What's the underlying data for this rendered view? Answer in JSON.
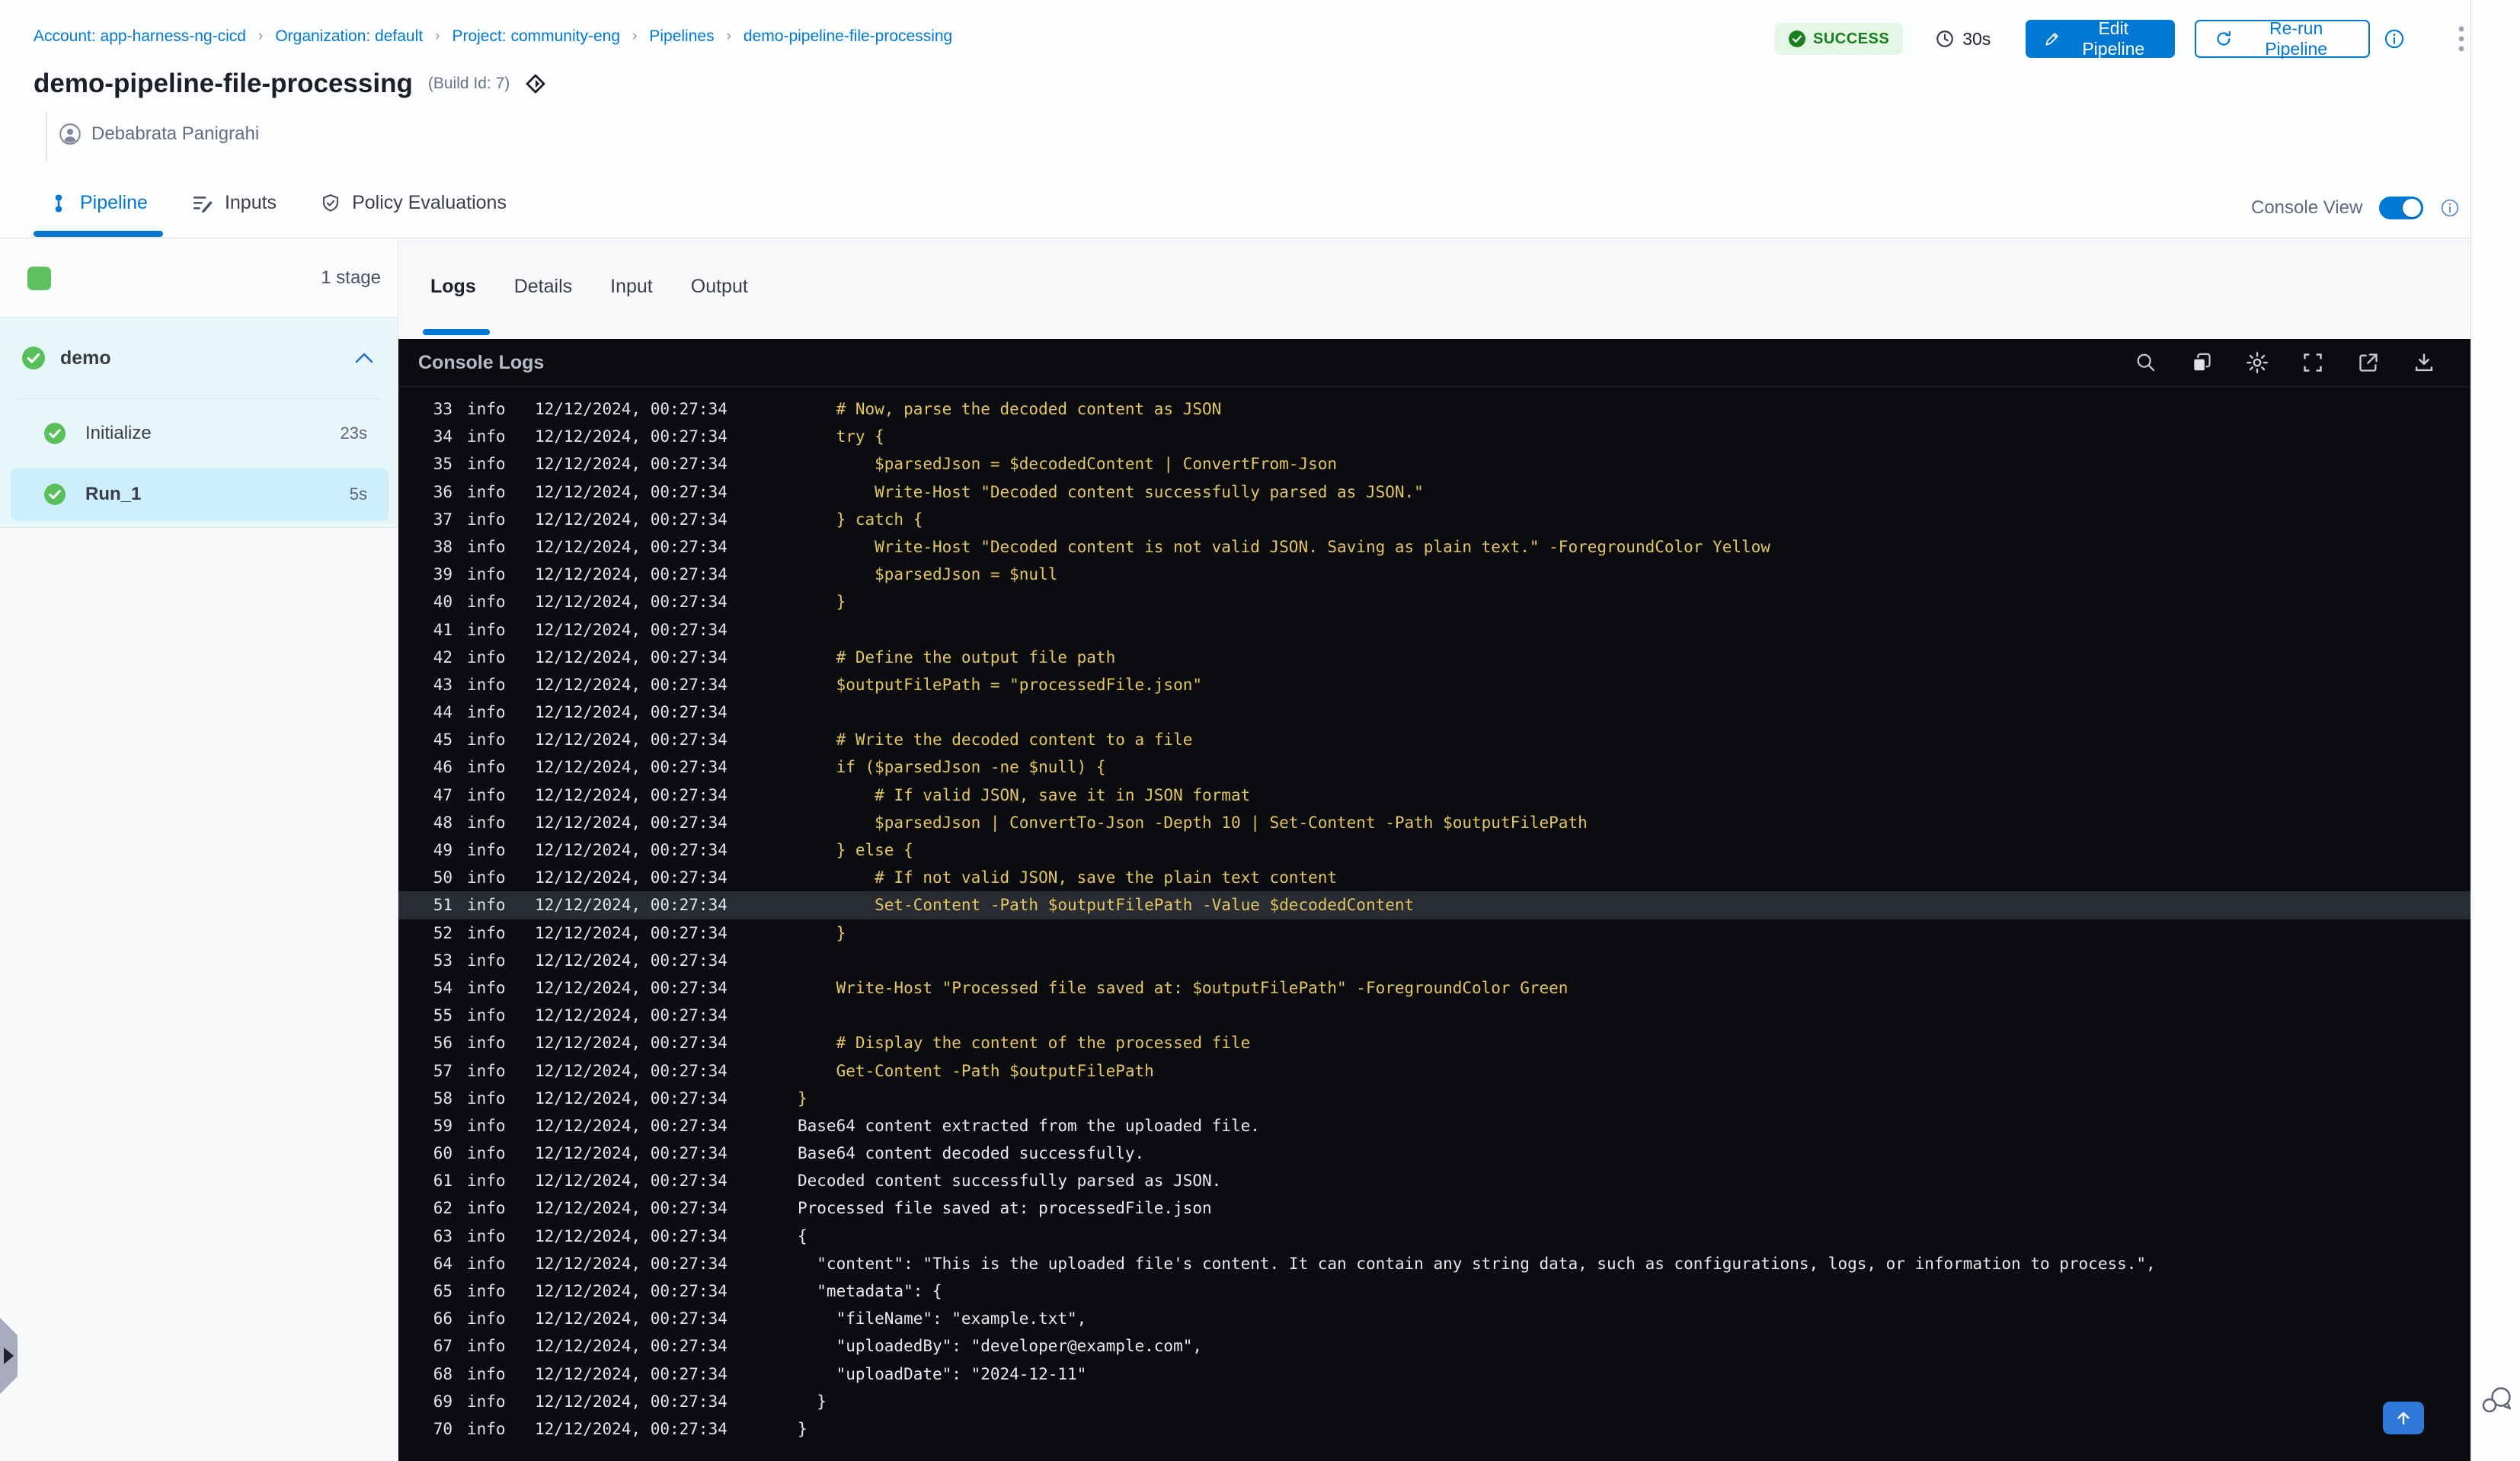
{
  "breadcrumb": {
    "separator": "›",
    "items": [
      "Account: app-harness-ng-cicd",
      "Organization: default",
      "Project: community-eng",
      "Pipelines",
      "demo-pipeline-file-processing"
    ]
  },
  "header": {
    "title": "demo-pipeline-file-processing",
    "build_id": "(Build Id: 7)",
    "author": "Debabrata Panigrahi",
    "status": "SUCCESS",
    "duration": "30s",
    "edit_button": "Edit Pipeline",
    "rerun_button": "Re-run Pipeline"
  },
  "tabs": {
    "items": [
      "Pipeline",
      "Inputs",
      "Policy Evaluations"
    ],
    "active": "Pipeline",
    "console_view_label": "Console View",
    "console_view_on": true
  },
  "sidebar": {
    "stage_count": "1 stage",
    "stage_group": {
      "name": "demo",
      "status": "success"
    },
    "steps": [
      {
        "name": "Initialize",
        "duration": "23s",
        "status": "success",
        "selected": false
      },
      {
        "name": "Run_1",
        "duration": "5s",
        "status": "success",
        "selected": true
      }
    ]
  },
  "console": {
    "tabs": [
      "Logs",
      "Details",
      "Input",
      "Output"
    ],
    "active_tab": "Logs",
    "title": "Console Logs",
    "icons": [
      "search-icon",
      "copy-icon",
      "settings-icon",
      "fullscreen-icon",
      "open-in-new-icon",
      "download-icon"
    ]
  },
  "logs": {
    "level": "info",
    "timestamp": "12/12/2024, 00:27:34",
    "highlighted_line": 51,
    "lines": [
      {
        "n": 33,
        "type": "script",
        "text": "    # Now, parse the decoded content as JSON"
      },
      {
        "n": 34,
        "type": "script",
        "text": "    try {"
      },
      {
        "n": 35,
        "type": "script",
        "text": "        $parsedJson = $decodedContent | ConvertFrom-Json"
      },
      {
        "n": 36,
        "type": "script",
        "text": "        Write-Host \"Decoded content successfully parsed as JSON.\""
      },
      {
        "n": 37,
        "type": "script",
        "text": "    } catch {"
      },
      {
        "n": 38,
        "type": "script",
        "text": "        Write-Host \"Decoded content is not valid JSON. Saving as plain text.\" -ForegroundColor Yellow"
      },
      {
        "n": 39,
        "type": "script",
        "text": "        $parsedJson = $null"
      },
      {
        "n": 40,
        "type": "script",
        "text": "    }"
      },
      {
        "n": 41,
        "type": "script",
        "text": ""
      },
      {
        "n": 42,
        "type": "script",
        "text": "    # Define the output file path"
      },
      {
        "n": 43,
        "type": "script",
        "text": "    $outputFilePath = \"processedFile.json\""
      },
      {
        "n": 44,
        "type": "script",
        "text": ""
      },
      {
        "n": 45,
        "type": "script",
        "text": "    # Write the decoded content to a file"
      },
      {
        "n": 46,
        "type": "script",
        "text": "    if ($parsedJson -ne $null) {"
      },
      {
        "n": 47,
        "type": "script",
        "text": "        # If valid JSON, save it in JSON format"
      },
      {
        "n": 48,
        "type": "script",
        "text": "        $parsedJson | ConvertTo-Json -Depth 10 | Set-Content -Path $outputFilePath"
      },
      {
        "n": 49,
        "type": "script",
        "text": "    } else {"
      },
      {
        "n": 50,
        "type": "script",
        "text": "        # If not valid JSON, save the plain text content"
      },
      {
        "n": 51,
        "type": "script",
        "text": "        Set-Content -Path $outputFilePath -Value $decodedContent"
      },
      {
        "n": 52,
        "type": "script",
        "text": "    }"
      },
      {
        "n": 53,
        "type": "script",
        "text": ""
      },
      {
        "n": 54,
        "type": "script",
        "text": "    Write-Host \"Processed file saved at: $outputFilePath\" -ForegroundColor Green"
      },
      {
        "n": 55,
        "type": "script",
        "text": ""
      },
      {
        "n": 56,
        "type": "script",
        "text": "    # Display the content of the processed file"
      },
      {
        "n": 57,
        "type": "script",
        "text": "    Get-Content -Path $outputFilePath"
      },
      {
        "n": 58,
        "type": "script",
        "text": "}"
      },
      {
        "n": 59,
        "type": "output",
        "text": "Base64 content extracted from the uploaded file."
      },
      {
        "n": 60,
        "type": "output",
        "text": "Base64 content decoded successfully."
      },
      {
        "n": 61,
        "type": "output",
        "text": "Decoded content successfully parsed as JSON."
      },
      {
        "n": 62,
        "type": "output",
        "text": "Processed file saved at: processedFile.json"
      },
      {
        "n": 63,
        "type": "output",
        "text": "{"
      },
      {
        "n": 64,
        "type": "output",
        "text": "  \"content\": \"This is the uploaded file's content. It can contain any string data, such as configurations, logs, or information to process.\","
      },
      {
        "n": 65,
        "type": "output",
        "text": "  \"metadata\": {"
      },
      {
        "n": 66,
        "type": "output",
        "text": "    \"fileName\": \"example.txt\","
      },
      {
        "n": 67,
        "type": "output",
        "text": "    \"uploadedBy\": \"developer@example.com\","
      },
      {
        "n": 68,
        "type": "output",
        "text": "    \"uploadDate\": \"2024-12-11\""
      },
      {
        "n": 69,
        "type": "output",
        "text": "  }"
      },
      {
        "n": 70,
        "type": "output",
        "text": "}"
      }
    ]
  },
  "colors": {
    "accent_blue": "#0278d5",
    "success_green": "#5ec05f",
    "badge_bg": "#e3f7e4",
    "badge_text": "#1a7d1e",
    "console_bg": "#0b0c0f",
    "log_script_yellow": "#e3c662",
    "log_output_white": "#e9e9ec",
    "selected_step_bg": "#cdeffb",
    "stage_group_bg": "#e7f6f8"
  }
}
